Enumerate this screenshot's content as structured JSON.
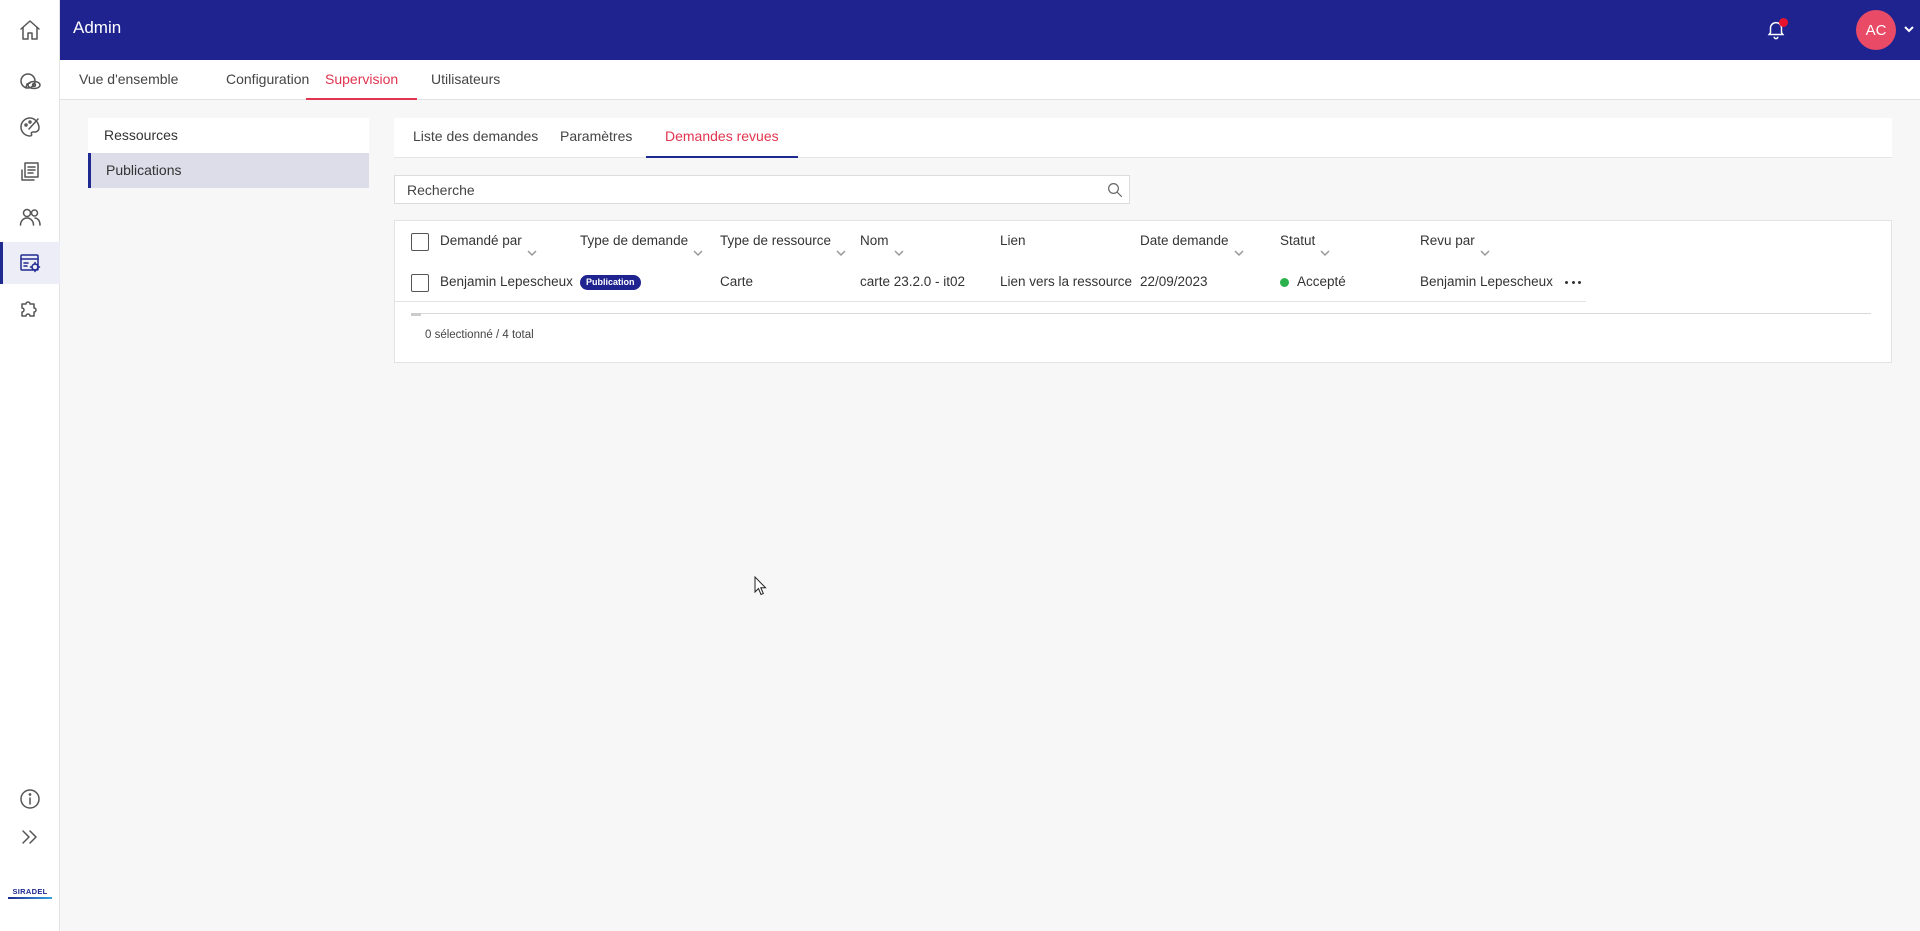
{
  "header": {
    "title": "Admin",
    "user_initials": "AC",
    "colors": {
      "brand": "#1e2390",
      "accent": "#e0344f",
      "avatar": "#e94b67",
      "notification": "#e8132e"
    }
  },
  "rail": {
    "items": [
      {
        "name": "home-icon"
      },
      {
        "name": "monitoring-icon"
      },
      {
        "name": "design-icon"
      },
      {
        "name": "documents-icon"
      },
      {
        "name": "users-icon"
      },
      {
        "name": "admin-settings-icon",
        "active": true
      },
      {
        "name": "extensions-icon"
      }
    ],
    "bottom": [
      {
        "name": "info-icon"
      },
      {
        "name": "expand-icon"
      }
    ],
    "logo_text": "SIRADEL"
  },
  "topnav": {
    "tabs": [
      {
        "label": "Vue d'ensemble"
      },
      {
        "label": "Configuration"
      },
      {
        "label": "Supervision",
        "active": true
      },
      {
        "label": "Utilisateurs"
      }
    ]
  },
  "sidemenu": {
    "items": [
      {
        "label": "Ressources"
      },
      {
        "label": "Publications",
        "active": true
      }
    ]
  },
  "subtabs": {
    "tabs": [
      {
        "label": "Liste des demandes"
      },
      {
        "label": "Paramètres"
      },
      {
        "label": "Demandes revues",
        "active": true
      }
    ]
  },
  "search": {
    "placeholder": "Recherche"
  },
  "table": {
    "columns": [
      "Demandé par",
      "Type de demande",
      "Type de ressource",
      "Nom",
      "Lien",
      "Date demande",
      "Statut",
      "Revu par"
    ],
    "rows": [
      {
        "requested_by": "Benjamin Lepescheux",
        "request_type": "Publication",
        "resource_type": "Carte",
        "name": "carte 23.2.0 - it02",
        "link": "Lien vers la ressource",
        "date": "22/09/2023",
        "status": "Accepté",
        "reviewed_by": "Benjamin Lepescheux"
      }
    ],
    "footer": "0 sélectionné / 4 total"
  }
}
